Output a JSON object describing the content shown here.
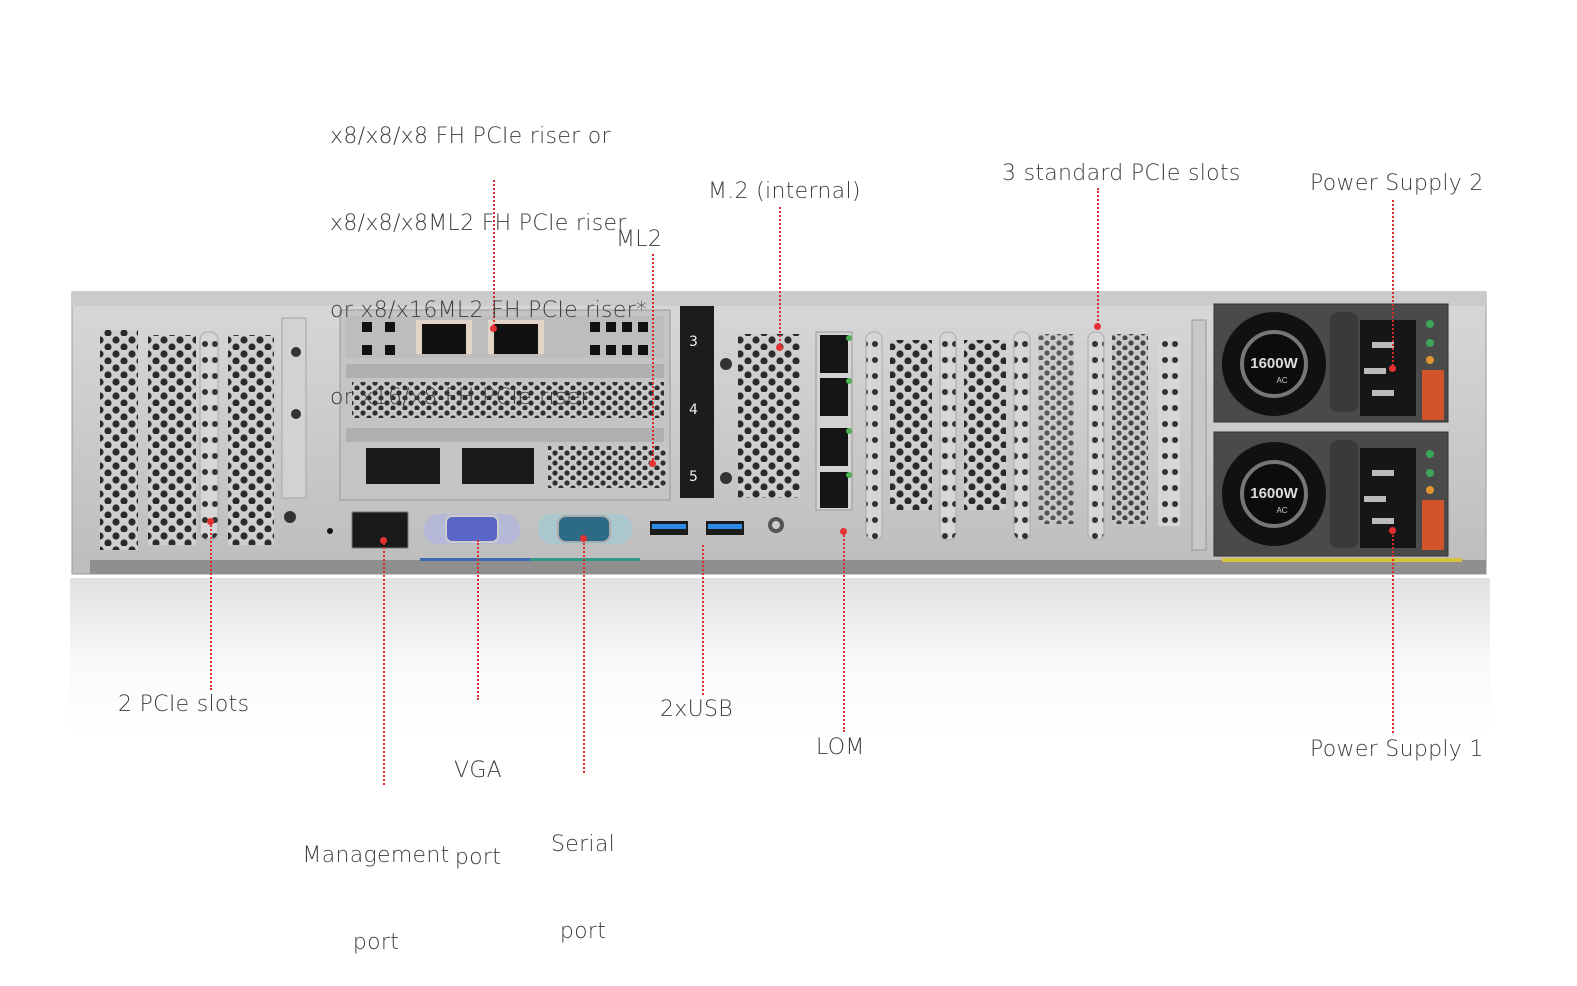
{
  "diagram": {
    "subject": "2U rack server rear view",
    "accent_color": "#e02a2a",
    "labels": {
      "riser1": [
        "x8/x8/x8 FH PCIe riser or",
        "x8/x8/x8ML2 FH PCIe riser",
        "or x8/x16ML2 FH PCIe riser*",
        "or x16/x8 FH PCIe riser"
      ],
      "ml2": "ML2",
      "m2": "M.2 (internal)",
      "standard_pcie": "3 standard PCIe slots",
      "psu2": "Power Supply 2",
      "psu1": "Power Supply 1",
      "two_pcie": "2 PCIe slots",
      "management": [
        "Management",
        "port"
      ],
      "vga": [
        "VGA",
        "port"
      ],
      "serial": [
        "Serial",
        "port"
      ],
      "usb": "2xUSB",
      "lom": "LOM"
    },
    "hardware": {
      "psu_rating": "1600W",
      "psu_type": "AC",
      "slot_numbers": [
        "3",
        "4",
        "5"
      ]
    }
  }
}
